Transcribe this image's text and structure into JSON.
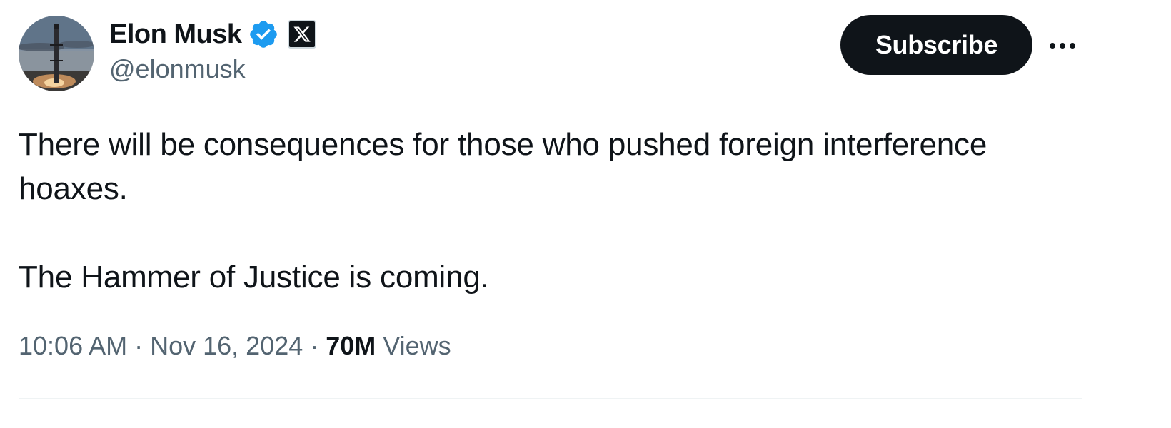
{
  "author": {
    "display_name": "Elon Musk",
    "handle": "@elonmusk",
    "verified": true,
    "verified_color": "#1d9bf0",
    "affiliate_badge": "x-logo-icon"
  },
  "actions": {
    "subscribe_label": "Subscribe",
    "more_icon": "more-horizontal-icon"
  },
  "tweet": {
    "lines": [
      "There will be consequences for those who pushed foreign interference",
      "hoaxes.",
      "",
      "The Hammer of Justice is coming."
    ]
  },
  "meta": {
    "time": "10:06 AM",
    "separator": "·",
    "date": "Nov 16, 2024",
    "views_count": "70M",
    "views_label": "Views"
  },
  "colors": {
    "text_primary": "#0f1419",
    "text_secondary": "#536471",
    "button_bg": "#0f1419",
    "divider": "#eff3f4"
  }
}
